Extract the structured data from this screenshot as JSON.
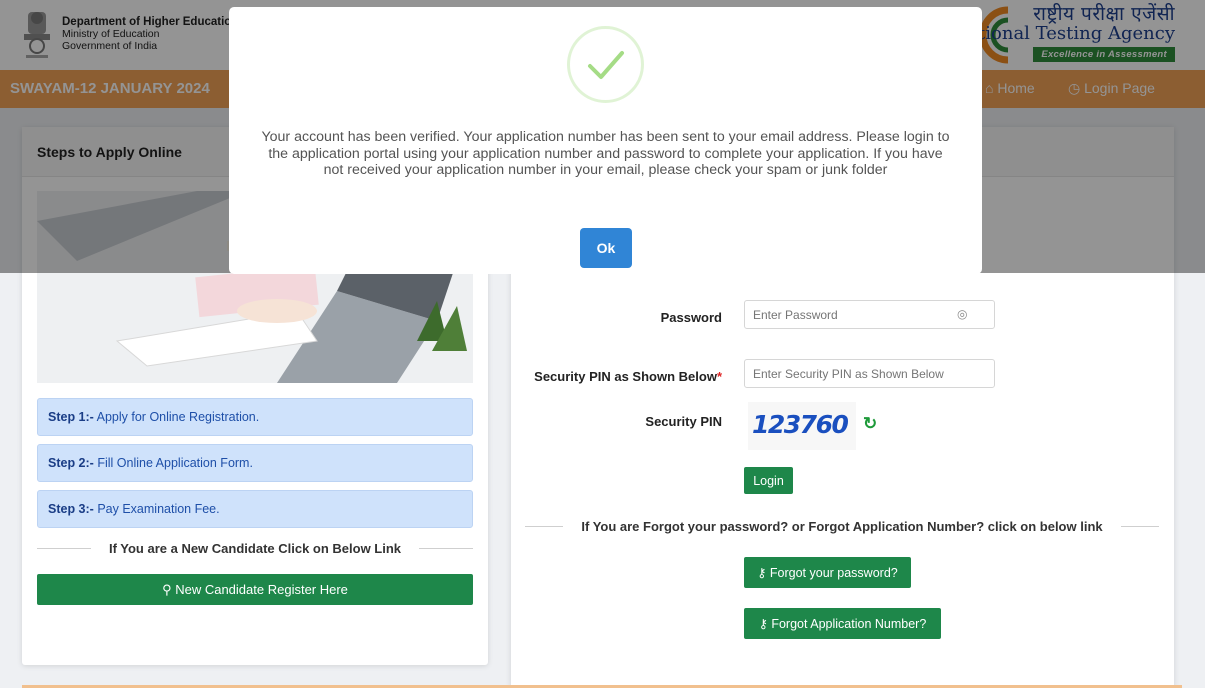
{
  "header": {
    "dept_line1": "Department of Higher Education",
    "dept_line2": "Ministry of Education",
    "dept_line3": "Government of India",
    "nta_hindi": "राष्ट्रीय परीक्षा एजेंसी",
    "nta_english": "National Testing Agency",
    "nta_tagline": "Excellence in Assessment"
  },
  "nav": {
    "title": "SWAYAM-12 JANUARY 2024",
    "home": "Home",
    "login_page": "Login Page"
  },
  "left_card": {
    "heading": "Steps to Apply Online",
    "steps": [
      {
        "label": "Step 1:-",
        "text": "Apply for Online Registration."
      },
      {
        "label": "Step 2:-",
        "text": "Fill Online Application Form."
      },
      {
        "label": "Step 3:-",
        "text": "Pay Examination Fee."
      }
    ],
    "new_candidate_text": "If You are a New Candidate Click on Below Link",
    "register_button": "New Candidate Register Here"
  },
  "login_form": {
    "password_label": "Password",
    "password_placeholder": "Enter Password",
    "security_pin_label": "Security PIN as Shown Below",
    "security_pin_placeholder": "Enter Security PIN as Shown Below",
    "captcha_label": "Security PIN",
    "captcha_value": "123760",
    "login_button": "Login",
    "forgot_text": "If You are Forgot your password? or Forgot Application Number? click on below link",
    "forgot_password_button": "Forgot your password?",
    "forgot_appno_button": "Forgot Application Number?"
  },
  "modal": {
    "message": "Your account has been verified. Your application number has been sent to your email address. Please login to the application portal using your application number and password to complete your application. If you have not received your application number in your email, please check your spam or junk folder",
    "ok_button": "Ok"
  },
  "colors": {
    "nav_orange": "#f1a257",
    "button_green": "#1e874a",
    "ok_blue": "#3085d6",
    "step_bg": "#cfe2fb",
    "success_green": "#a5dc86"
  }
}
